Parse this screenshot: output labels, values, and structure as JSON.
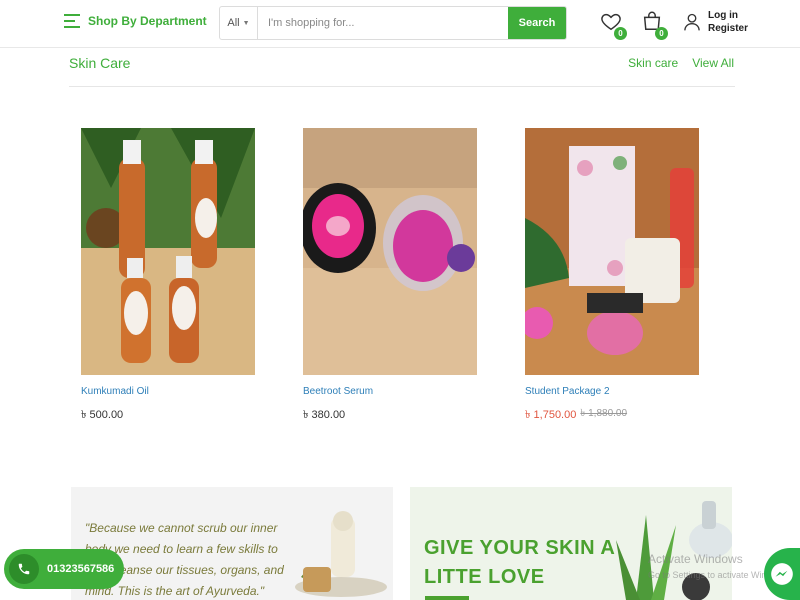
{
  "header": {
    "department_label": "Shop By Department",
    "search": {
      "category": "All",
      "placeholder": "I'm shopping for...",
      "button_label": "Search"
    },
    "wishlist_count": "0",
    "cart_count": "0",
    "login_label": "Log in",
    "register_label": "Register"
  },
  "section": {
    "title": "Skin Care",
    "links": [
      "Skin care",
      "View All"
    ]
  },
  "products": [
    {
      "name": "Kumkumadi Oil",
      "price": "৳ 500.00"
    },
    {
      "name": "Beetroot Serum",
      "price": "৳ 380.00"
    },
    {
      "name": "Student Package 2",
      "sale_price": "৳ 1,750.00",
      "old_price": "৳ 1,880.00"
    }
  ],
  "banners": {
    "left_quote": "\"Because we cannot scrub our inner body we need to learn a few skills to help cleanse our tissues, organs, and mind. This is the art of Ayurveda.\"",
    "right_slogan_line1": "GIVE YOUR SKIN A",
    "right_slogan_line2": "LITTE LOVE"
  },
  "watermark": {
    "line1": "Activate Windows",
    "line2": "Go to Settings to activate Windows."
  },
  "contact": {
    "phone": "01323567586"
  },
  "colors": {
    "brand_green": "#3fae3b",
    "link_blue": "#2e7fb8",
    "sale_red": "#e0553f"
  }
}
